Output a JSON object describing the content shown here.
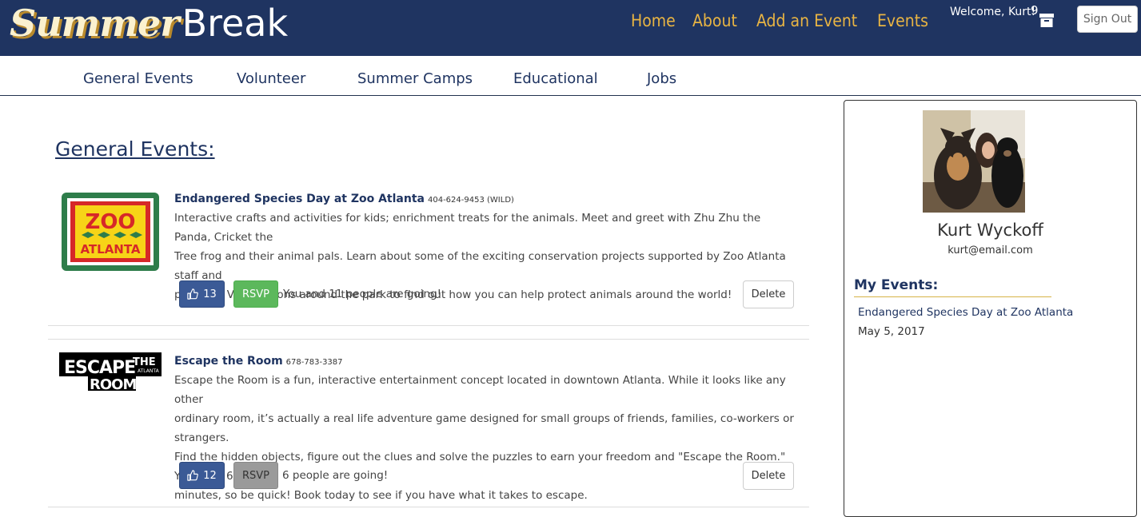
{
  "brand": {
    "part1": "Summer",
    "part2": "Break"
  },
  "topnav": {
    "home": "Home",
    "about": "About",
    "add_event": "Add an Event",
    "events": "Events"
  },
  "user": {
    "welcome": "Welcome, Kurt!",
    "badge_count": "9",
    "signout": "Sign Out"
  },
  "subnav": [
    "General Events",
    "Volunteer",
    "Summer Camps",
    "Educational",
    "Jobs"
  ],
  "page_title": "General Events:",
  "events": [
    {
      "title": "Endangered Species Day at Zoo Atlanta",
      "phone": "404-624-9453 (WILD)",
      "logo_text": [
        "ZOO",
        "ATLANTA"
      ],
      "desc_lines": [
        "Interactive crafts and activities for kids; enrichment treats for the animals. Meet and greet with Zhu Zhu the Panda, Cricket the",
        "Tree frog and their animal pals. Learn about some of the exciting conservation projects supported by Zoo Atlanta staff and",
        "partners. Visit stations around the park to find out how you can help protect animals around the world!"
      ],
      "likes": "13",
      "rsvp": "RSVP",
      "going": "You and  11 people are going!",
      "delete": "Delete"
    },
    {
      "title": "Escape the Room",
      "phone": "678-783-3387",
      "logo_text": [
        "ESCAPE",
        "THE",
        "ATLANTA",
        "ROOM"
      ],
      "desc_lines": [
        "Escape the Room is a fun, interactive entertainment concept located in downtown Atlanta.  While it looks like any other",
        "ordinary room, it’s actually a real life adventure game designed for small groups of friends, families, co-workers or strangers.",
        "Find the hidden objects, figure out the clues and solve the puzzles to earn your freedom and \"Escape the Room.\"  You have 60",
        "minutes, so be quick! Book today to see if you have what it takes to escape."
      ],
      "likes": "12",
      "rsvp": "RSVP",
      "going": "6 people are going!",
      "delete": "Delete"
    }
  ],
  "profile": {
    "name": "Kurt Wyckoff",
    "email": "kurt@email.com",
    "my_events_heading": "My Events:",
    "my_events": [
      {
        "title": "Endangered Species Day at Zoo Atlanta",
        "date": "May 5, 2017"
      }
    ]
  },
  "icons": {
    "archive": "archive-icon",
    "like": "thumbs-up-icon"
  },
  "colors": {
    "navbar": "#1f3461",
    "nav_link": "#e8b443",
    "like_button": "#3b5a96",
    "rsvp_active": "#5cb85c",
    "rsvp_inactive": "#9a9a9a"
  }
}
